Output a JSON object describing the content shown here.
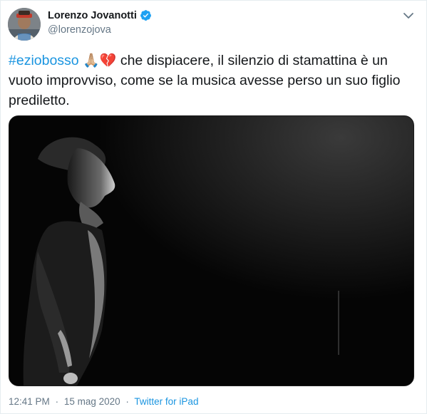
{
  "author": {
    "display_name": "Lorenzo Jovanotti",
    "handle": "@lorenzojova",
    "verified": true
  },
  "tweet": {
    "hashtag": "#eziobosso",
    "emoji_1": "🙏🏼",
    "emoji_2": "💔",
    "text": " che dispiacere, il silenzio di stamattina è un vuoto improvviso, come se la musica avesse perso un suo figlio prediletto."
  },
  "meta": {
    "time": "12:41 PM",
    "separator_1": "·",
    "date": "15 mag 2020",
    "separator_2": "·",
    "source": "Twitter for iPad"
  },
  "icons": {
    "verified": "verified-badge-icon",
    "menu": "chevron-down-icon"
  },
  "colors": {
    "link": "#1b95e0",
    "secondary_text": "#657786",
    "primary_text": "#14171a",
    "border": "#e6ecf0"
  }
}
